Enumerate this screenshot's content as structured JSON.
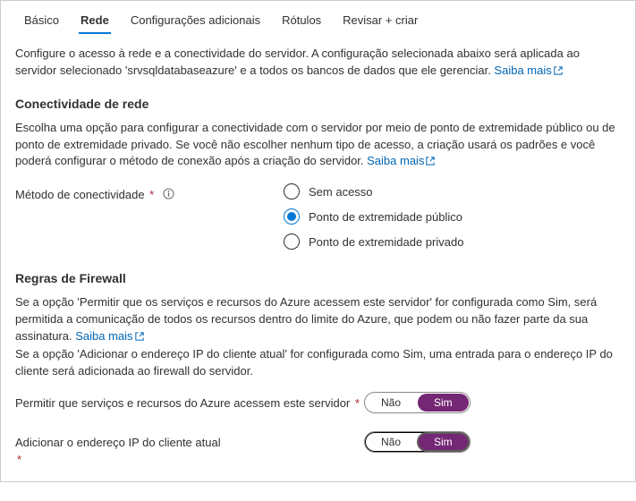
{
  "tabs": {
    "basic": "Básico",
    "network": "Rede",
    "additional": "Configurações adicionais",
    "tags": "Rótulos",
    "review": "Revisar + criar"
  },
  "intro": {
    "text1": "Configure o acesso à rede e a conectividade do servidor. A configuração selecionada abaixo será aplicada ao servidor selecionado 'srvsqldatabaseazure' e a todos os bancos de dados que ele gerenciar. ",
    "link": "Saiba mais"
  },
  "connectivity": {
    "heading": "Conectividade de rede",
    "desc": "Escolha uma opção para configurar a conectividade com o servidor por meio de ponto de extremidade público ou de ponto de extremidade privado. Se você não escolher nenhum tipo de acesso, a criação usará os padrões e você poderá configurar o método de conexão após a criação do servidor. ",
    "link": "Saiba mais",
    "label": "Método de conectividade",
    "options": {
      "none": "Sem acesso",
      "public": "Ponto de extremidade público",
      "private": "Ponto de extremidade privado"
    }
  },
  "firewall": {
    "heading": "Regras de Firewall",
    "desc1a": "Se a opção 'Permitir que os serviços e recursos do Azure acessem este servidor' for configurada como Sim, será permitida a comunicação de todos os recursos dentro do limite do Azure, que podem ou não fazer parte da sua assinatura. ",
    "link": "Saiba mais",
    "desc2": "Se a opção 'Adicionar o endereço IP do cliente atual' for configurada como Sim, uma entrada para o endereço IP do cliente será adicionada ao firewall do servidor.",
    "allow_label": "Permitir que serviços e recursos do Azure acessem este servidor",
    "addip_label": "Adicionar o endereço IP do cliente atual",
    "no": "Não",
    "yes": "Sim"
  }
}
